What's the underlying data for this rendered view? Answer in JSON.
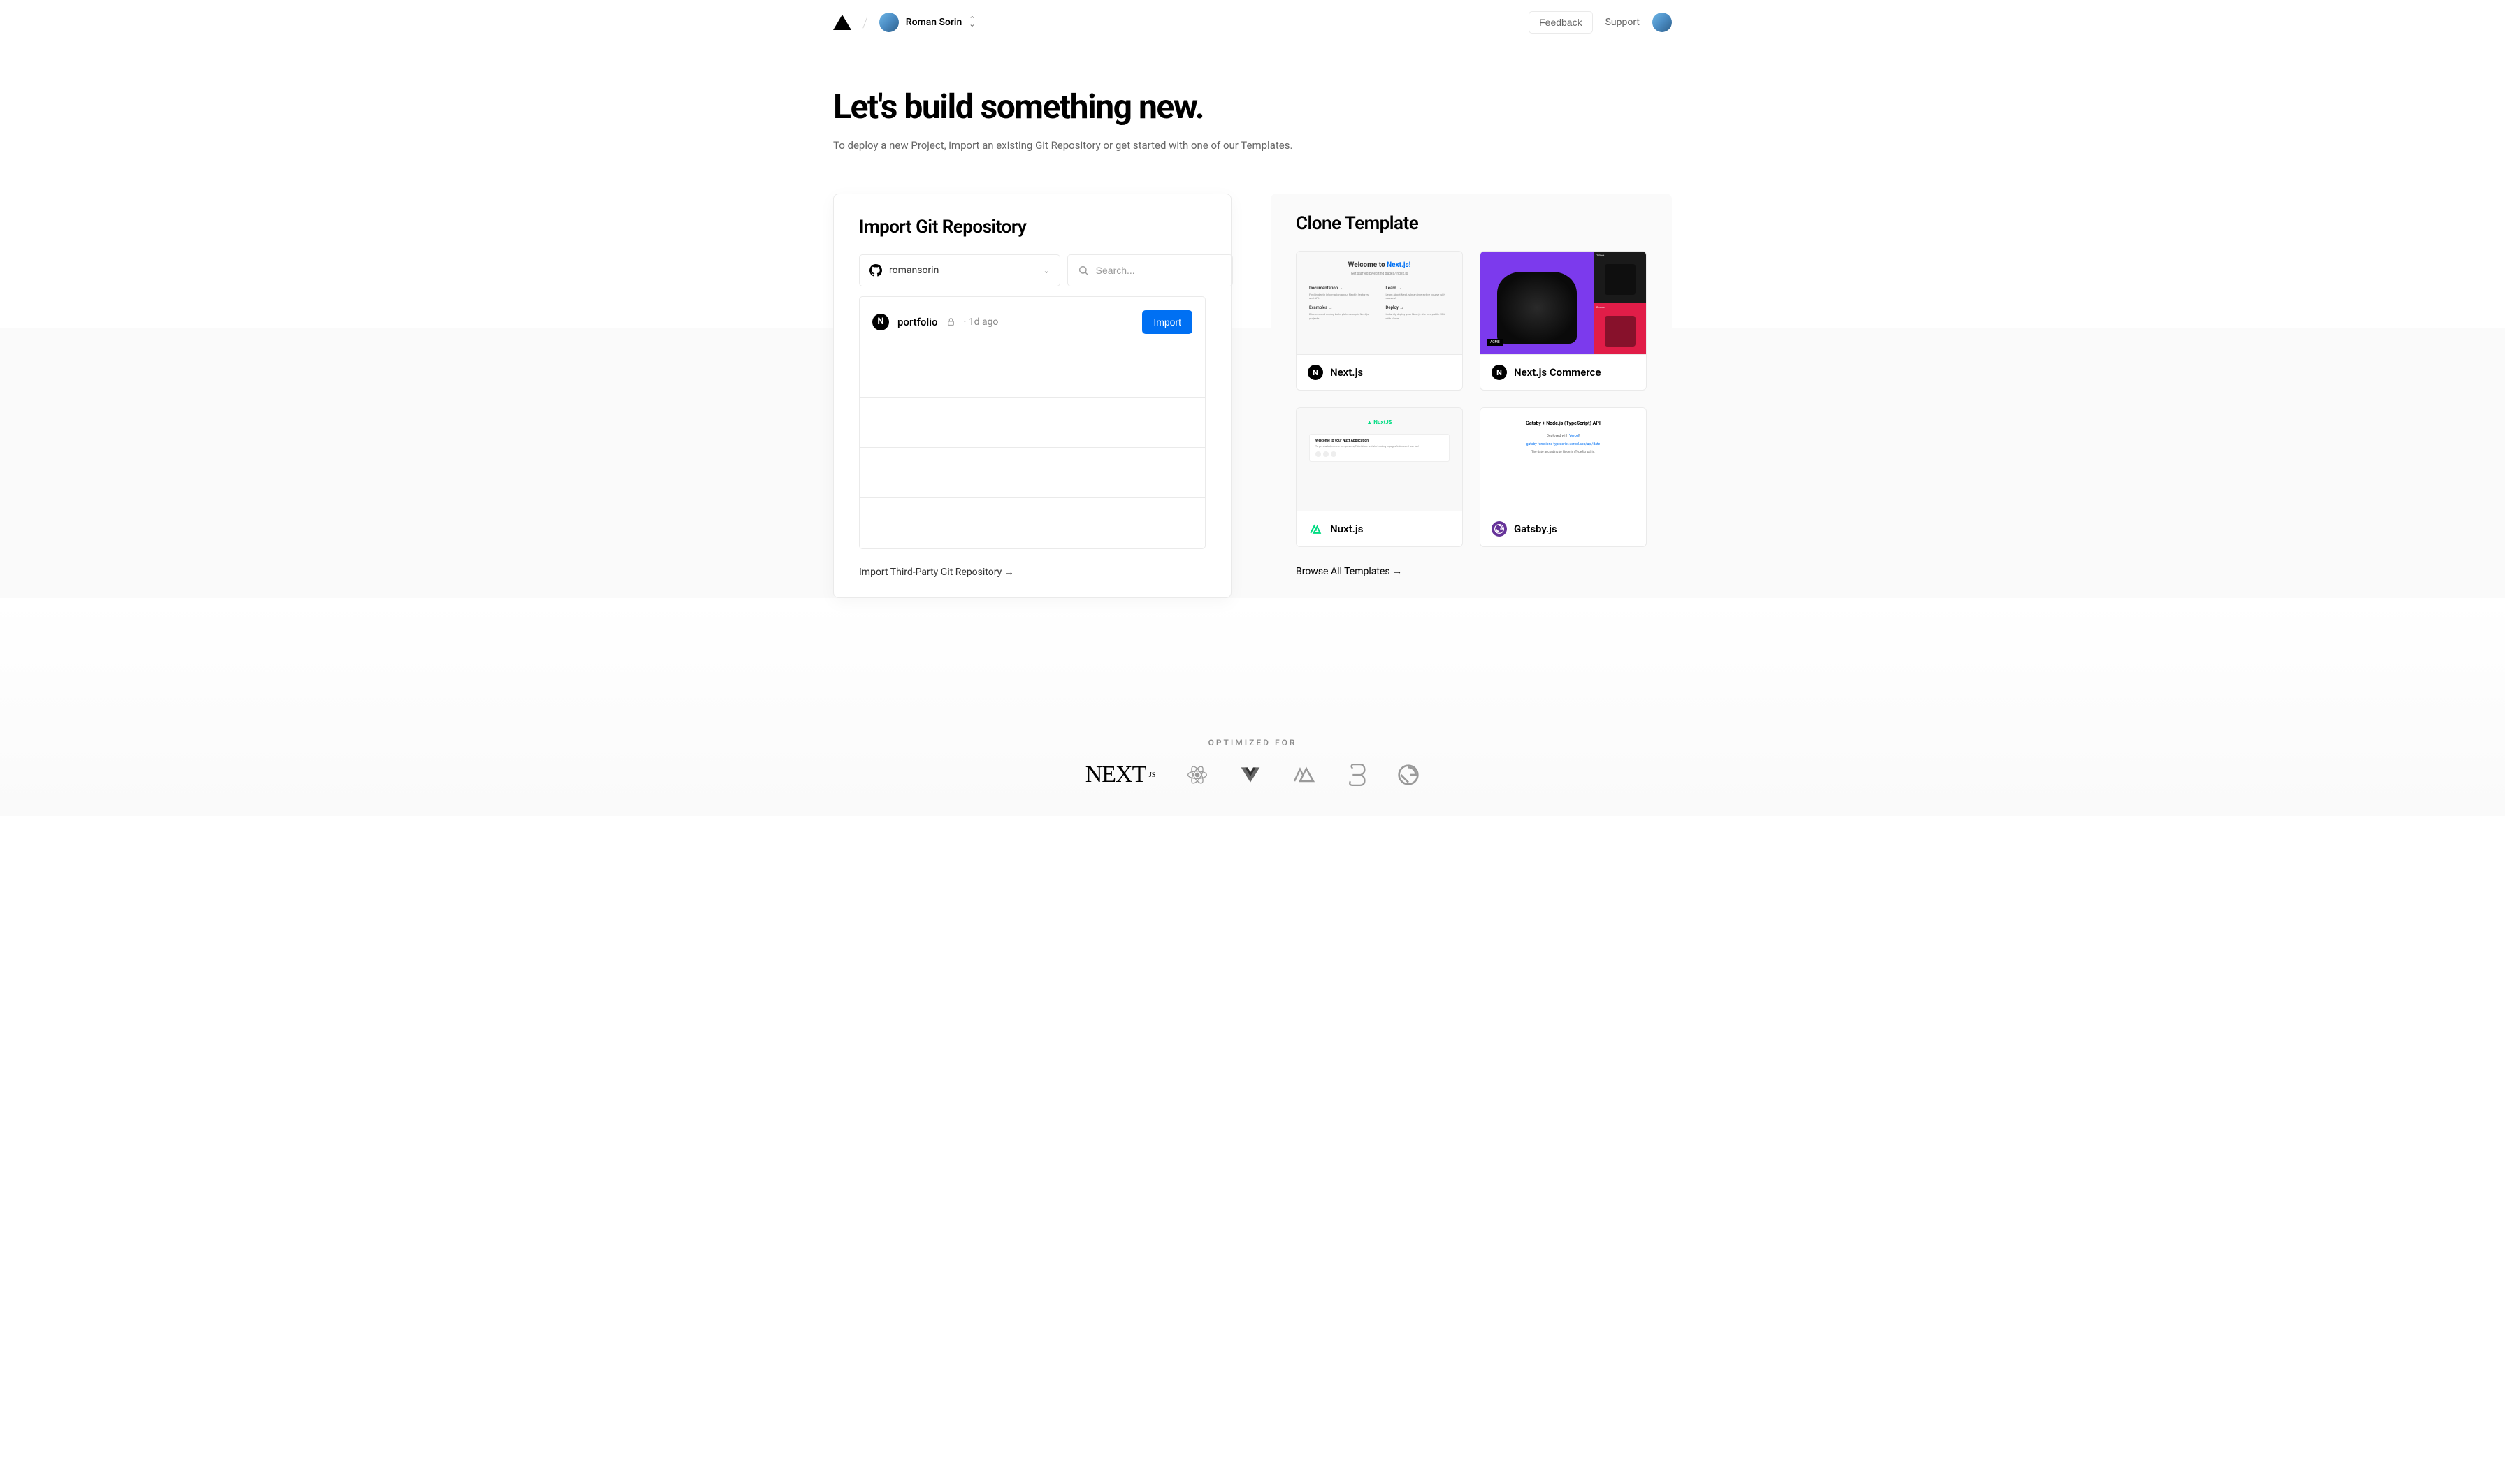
{
  "header": {
    "account_name": "Roman Sorin",
    "feedback": "Feedback",
    "support": "Support"
  },
  "page": {
    "title": "Let's build something new.",
    "subtitle": "To deploy a new Project, import an existing Git Repository or get started with one of our Templates."
  },
  "import": {
    "title": "Import Git Repository",
    "account_selected": "romansorin",
    "search_placeholder": "Search...",
    "repos": [
      {
        "name": "portfolio",
        "age": "1d ago",
        "private": true
      }
    ],
    "import_button": "Import",
    "third_party": "Import Third-Party Git Repository →"
  },
  "clone": {
    "title": "Clone Template",
    "templates": [
      {
        "name": "Next.js"
      },
      {
        "name": "Next.js Commerce"
      },
      {
        "name": "Nuxt.js"
      },
      {
        "name": "Gatsby.js"
      }
    ],
    "browse_all": "Browse All Templates →"
  },
  "optimized": {
    "label": "OPTIMIZED FOR"
  },
  "thumb": {
    "nextjs_welcome_a": "Welcome to ",
    "nextjs_welcome_b": "Next.js!",
    "gatsby_title": "Gatsby + Node.js (TypeScript) API",
    "nuxt_logo": "▲ NuxtJS"
  }
}
